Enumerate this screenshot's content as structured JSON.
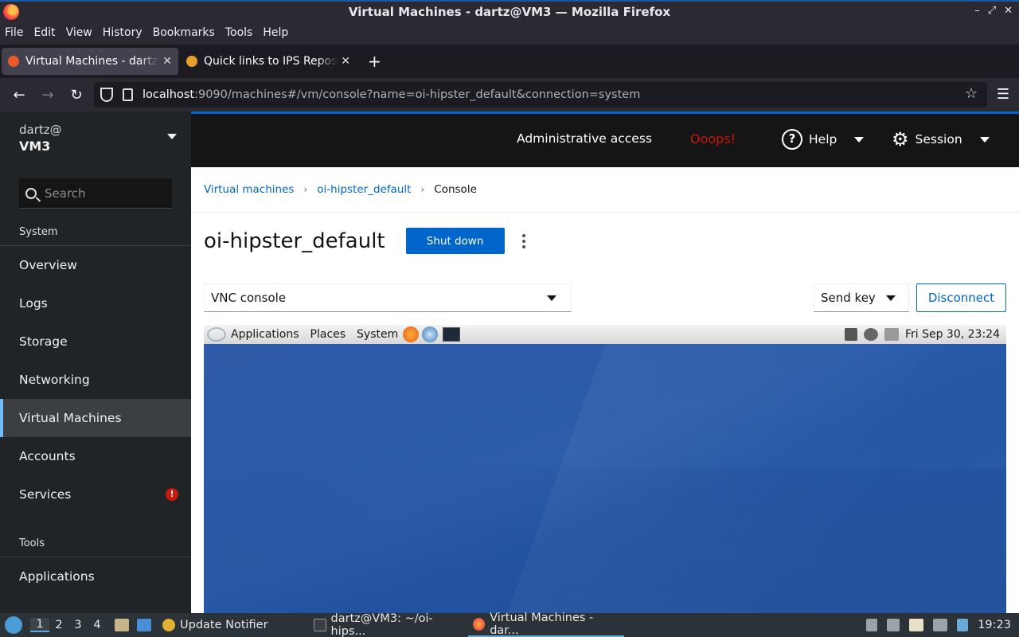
{
  "window": {
    "title": "Virtual Machines - dartz@VM3 — Mozilla Firefox",
    "controls": [
      "–",
      "⤢",
      "✕"
    ]
  },
  "menubar": [
    "File",
    "Edit",
    "View",
    "History",
    "Bookmarks",
    "Tools",
    "Help"
  ],
  "tabs": [
    {
      "title": "Virtual Machines - dartz@VM3",
      "active": true
    },
    {
      "title": "Quick links to IPS Repositories",
      "active": false
    }
  ],
  "navbar": {
    "url_host": "localhost",
    "url_rest": ":9090/machines#/vm/console?name=oi-hipster_default&connection=system"
  },
  "sidebar": {
    "user": "dartz@",
    "host": "VM3",
    "search_placeholder": "Search",
    "section_system": "System",
    "items": [
      {
        "label": "Overview"
      },
      {
        "label": "Logs"
      },
      {
        "label": "Storage"
      },
      {
        "label": "Networking"
      },
      {
        "label": "Virtual Machines",
        "active": true
      },
      {
        "label": "Accounts"
      },
      {
        "label": "Services",
        "alert": "!"
      }
    ],
    "section_tools": "Tools",
    "tools_items": [
      {
        "label": "Applications"
      }
    ]
  },
  "header": {
    "admin": "Administrative access",
    "oops": "Ooops!",
    "help": "Help",
    "session": "Session"
  },
  "breadcrumb": {
    "items": [
      "Virtual machines",
      "oi-hipster_default",
      "Console"
    ]
  },
  "vm": {
    "name": "oi-hipster_default",
    "shutdown_label": "Shut down",
    "console_type": "VNC console",
    "sendkey_label": "Send key",
    "disconnect_label": "Disconnect"
  },
  "guest": {
    "menus": [
      "Applications",
      "Places",
      "System"
    ],
    "clock": "Fri Sep 30, 23:24"
  },
  "taskbar": {
    "workspaces": [
      "1",
      "2",
      "3",
      "4"
    ],
    "tasks": [
      {
        "label": "Update Notifier"
      },
      {
        "label": "dartz@VM3: ~/oi-hips..."
      },
      {
        "label": "Virtual Machines - dar...",
        "active": true
      }
    ],
    "clock": "19:23"
  },
  "colors": {
    "accent": "#0066cc",
    "oops": "#c9190b",
    "sidebar_bg": "#212427",
    "header_bg": "#151515"
  }
}
